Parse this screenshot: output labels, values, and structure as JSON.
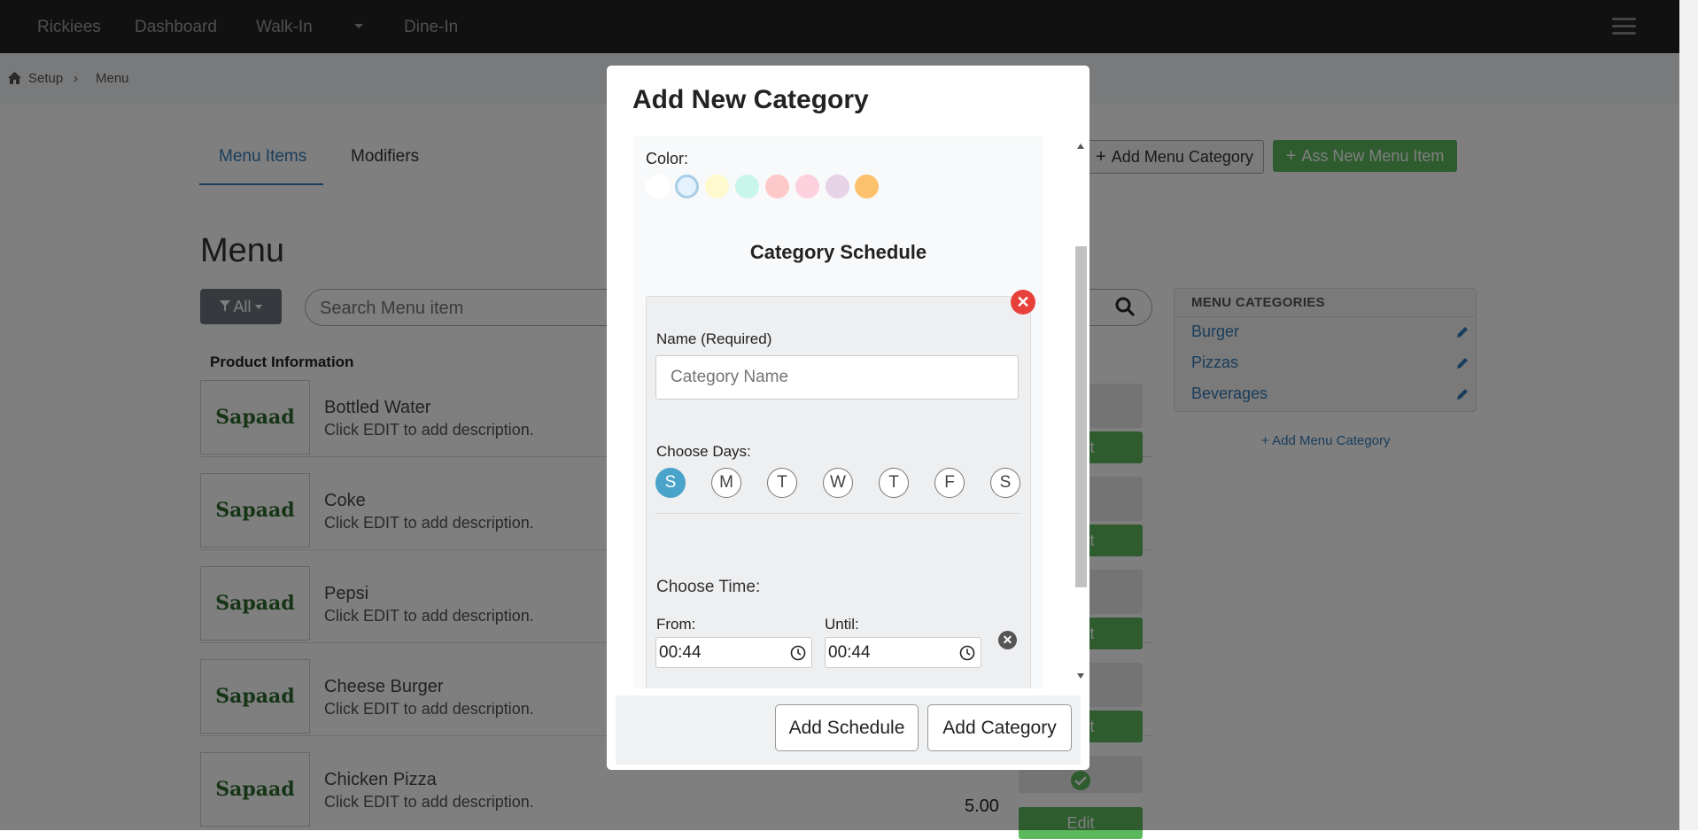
{
  "nav": {
    "brand": "Rickiees",
    "links": [
      "Dashboard",
      "Walk-In",
      "Dine-In"
    ],
    "menu_icon": "hamburger-icon"
  },
  "breadcrumb": {
    "home_icon": "home-icon",
    "items": [
      "Setup",
      "Menu"
    ],
    "separator": "›"
  },
  "tabs": [
    {
      "label": "Menu Items",
      "active": true
    },
    {
      "label": "Modifiers",
      "active": false
    }
  ],
  "page_title": "Menu",
  "filter": {
    "label": "All"
  },
  "search": {
    "placeholder": "Search Menu item"
  },
  "actions": {
    "add_category": "Add Menu Category",
    "add_item": "Ass New Menu Item"
  },
  "table": {
    "header": "Product Information"
  },
  "logo_text": "Sapaad",
  "products": [
    {
      "name": "Bottled Water",
      "description": "Click EDIT to add description.",
      "price": "",
      "edit": "Edit"
    },
    {
      "name": "Coke",
      "description": "Click EDIT to add description.",
      "price": "",
      "edit": "Edit"
    },
    {
      "name": "Pepsi",
      "description": "Click EDIT to add description.",
      "price": "",
      "edit": "Edit"
    },
    {
      "name": "Cheese Burger",
      "description": "Click EDIT to add description.",
      "price": "",
      "edit": "Edit"
    },
    {
      "name": "Chicken Pizza",
      "description": "Click EDIT to add description.",
      "price": "5.00",
      "edit": "Edit"
    }
  ],
  "categories_panel": {
    "heading": "MENU CATEGORIES",
    "items": [
      "Burger",
      "Pizzas",
      "Beverages"
    ],
    "add_link": "+ Add Menu Category"
  },
  "modal": {
    "title": "Add New Category",
    "color_label": "Color:",
    "colors": [
      "#ffffff",
      "#e3f2fd",
      "#fffacd",
      "#c8f7e9",
      "#ffc8c8",
      "#fcd0dd",
      "#e6d3e6",
      "#fbc16d"
    ],
    "selected_color_index": 1,
    "schedule_title": "Category Schedule",
    "name_label": "Name (Required)",
    "name_placeholder": "Category Name",
    "days_label": "Choose Days:",
    "days": [
      "S",
      "M",
      "T",
      "W",
      "T",
      "F",
      "S"
    ],
    "active_day_index": 0,
    "time_label": "Choose Time:",
    "from_label": "From:",
    "until_label": "Until:",
    "from_value": "00:44",
    "until_value": "00:44",
    "buttons": {
      "add_schedule": "Add Schedule",
      "add_category": "Add Category"
    }
  }
}
